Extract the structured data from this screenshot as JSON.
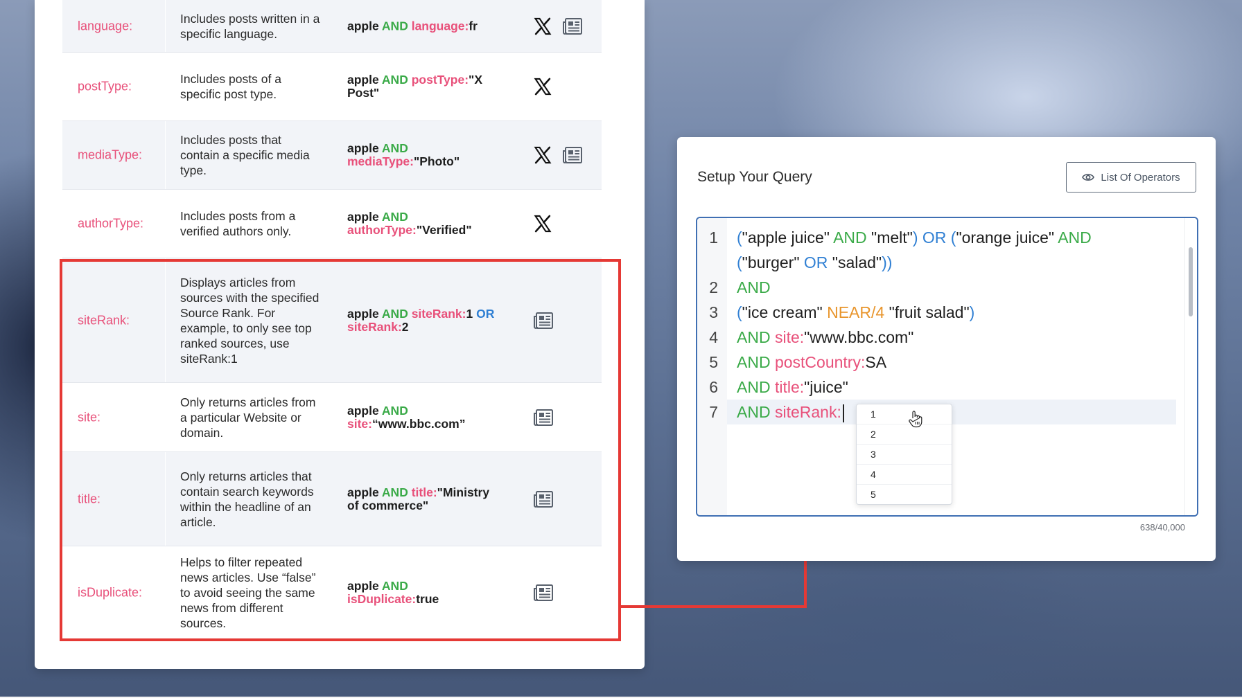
{
  "operators_table": {
    "rows": [
      {
        "operator": "language:",
        "description": "Includes posts written in a specific language.",
        "example": [
          {
            "t": "apple ",
            "k": "text"
          },
          {
            "t": "AND ",
            "k": "and"
          },
          {
            "t": "language:",
            "k": "field"
          },
          {
            "t": "fr",
            "k": "text"
          }
        ],
        "sources": [
          "x-icon",
          "news-icon"
        ]
      },
      {
        "operator": "postType:",
        "description": "Includes posts of a specific post type.",
        "example": [
          {
            "t": "apple ",
            "k": "text"
          },
          {
            "t": "AND ",
            "k": "and"
          },
          {
            "t": "postType:",
            "k": "field"
          },
          {
            "t": "\"X Post\"",
            "k": "text"
          }
        ],
        "sources": [
          "x-icon"
        ]
      },
      {
        "operator": "mediaType:",
        "description": "Includes posts that contain a specific media type.",
        "example": [
          {
            "t": "apple ",
            "k": "text"
          },
          {
            "t": "AND ",
            "k": "and"
          },
          {
            "t": "mediaType:",
            "k": "field"
          },
          {
            "t": "\"Photo\"",
            "k": "text"
          }
        ],
        "sources": [
          "x-icon",
          "news-icon"
        ]
      },
      {
        "operator": "authorType:",
        "description": "Includes posts from a verified authors only.",
        "example": [
          {
            "t": "apple ",
            "k": "text"
          },
          {
            "t": "AND ",
            "k": "and"
          },
          {
            "t": "authorType:",
            "k": "field"
          },
          {
            "t": "\"Verified\"",
            "k": "text"
          }
        ],
        "sources": [
          "x-icon"
        ]
      },
      {
        "operator": "siteRank:",
        "description": "Displays articles from sources with the specified Source Rank. For example, to only see top ranked sources, use siteRank:1",
        "example": [
          {
            "t": "apple ",
            "k": "text"
          },
          {
            "t": "AND ",
            "k": "and"
          },
          {
            "t": "siteRank:",
            "k": "field"
          },
          {
            "t": "1 ",
            "k": "text"
          },
          {
            "t": "OR ",
            "k": "or"
          },
          {
            "t": "siteRank:",
            "k": "field"
          },
          {
            "t": "2",
            "k": "text"
          }
        ],
        "sources": [
          "news-icon"
        ]
      },
      {
        "operator": "site:",
        "description": "Only returns articles from a particular Website or domain.",
        "example": [
          {
            "t": "apple ",
            "k": "text"
          },
          {
            "t": "AND ",
            "k": "and"
          },
          {
            "t": "site:",
            "k": "field"
          },
          {
            "t": "“www.bbc.com”",
            "k": "text"
          }
        ],
        "sources": [
          "news-icon"
        ]
      },
      {
        "operator": "title:",
        "description": "Only returns articles that contain search keywords within the headline of an article.",
        "example": [
          {
            "t": "apple ",
            "k": "text"
          },
          {
            "t": "AND ",
            "k": "and"
          },
          {
            "t": "title:",
            "k": "field"
          },
          {
            "t": "\"Ministry of commerce\"",
            "k": "text"
          }
        ],
        "sources": [
          "news-icon"
        ]
      },
      {
        "operator": "isDuplicate:",
        "description": "Helps to filter repeated news articles. Use “false” to avoid seeing the same news from different sources.",
        "example": [
          {
            "t": "apple ",
            "k": "text"
          },
          {
            "t": "AND ",
            "k": "and"
          },
          {
            "t": "isDuplicate:",
            "k": "field"
          },
          {
            "t": "true",
            "k": "text"
          }
        ],
        "sources": [
          "news-icon"
        ]
      }
    ]
  },
  "query_panel": {
    "title": "Setup Your Query",
    "operators_button_label": "List Of Operators",
    "char_count": "638/40,000",
    "line_numbers": [
      "1",
      "2",
      "3",
      "4",
      "5",
      "6",
      "7"
    ],
    "code_lines": [
      [
        {
          "t": "(",
          "k": "paren"
        },
        {
          "t": "\"apple juice\" ",
          "k": "text"
        },
        {
          "t": "AND ",
          "k": "and"
        },
        {
          "t": "\"melt\"",
          "k": "text"
        },
        {
          "t": ") ",
          "k": "paren"
        },
        {
          "t": "OR ",
          "k": "or"
        },
        {
          "t": "(",
          "k": "paren"
        },
        {
          "t": "\"orange juice\" ",
          "k": "text"
        },
        {
          "t": "AND",
          "k": "and"
        }
      ],
      [
        {
          "t": "(",
          "k": "paren"
        },
        {
          "t": "\"burger\" ",
          "k": "text"
        },
        {
          "t": "OR ",
          "k": "or"
        },
        {
          "t": "\"salad\"",
          "k": "text"
        },
        {
          "t": "))",
          "k": "paren"
        }
      ],
      [
        {
          "t": "AND",
          "k": "and"
        }
      ],
      [
        {
          "t": "(",
          "k": "paren"
        },
        {
          "t": "\"ice cream\" ",
          "k": "text"
        },
        {
          "t": "NEAR/4 ",
          "k": "near"
        },
        {
          "t": "\"fruit salad\"",
          "k": "text"
        },
        {
          "t": ")",
          "k": "paren"
        }
      ],
      [
        {
          "t": "AND ",
          "k": "and"
        },
        {
          "t": "site:",
          "k": "field"
        },
        {
          "t": "\"www.bbc.com\"",
          "k": "text"
        }
      ],
      [
        {
          "t": "AND ",
          "k": "and"
        },
        {
          "t": "postCountry:",
          "k": "field"
        },
        {
          "t": "SA",
          "k": "text"
        }
      ],
      [
        {
          "t": "AND ",
          "k": "and"
        },
        {
          "t": "title:",
          "k": "field"
        },
        {
          "t": "\"juice\"",
          "k": "text"
        }
      ],
      [
        {
          "t": "AND ",
          "k": "and"
        },
        {
          "t": "siteRank:",
          "k": "field"
        }
      ]
    ],
    "suggestions": [
      "1",
      "2",
      "3",
      "4",
      "5"
    ]
  },
  "colors": {
    "operator_pink": "#e8507a",
    "and_green": "#3aaa48",
    "or_blue": "#2f7fd3",
    "near_orange": "#e8952c",
    "highlight_red": "#e53935",
    "editor_border": "#3f6fb3"
  }
}
